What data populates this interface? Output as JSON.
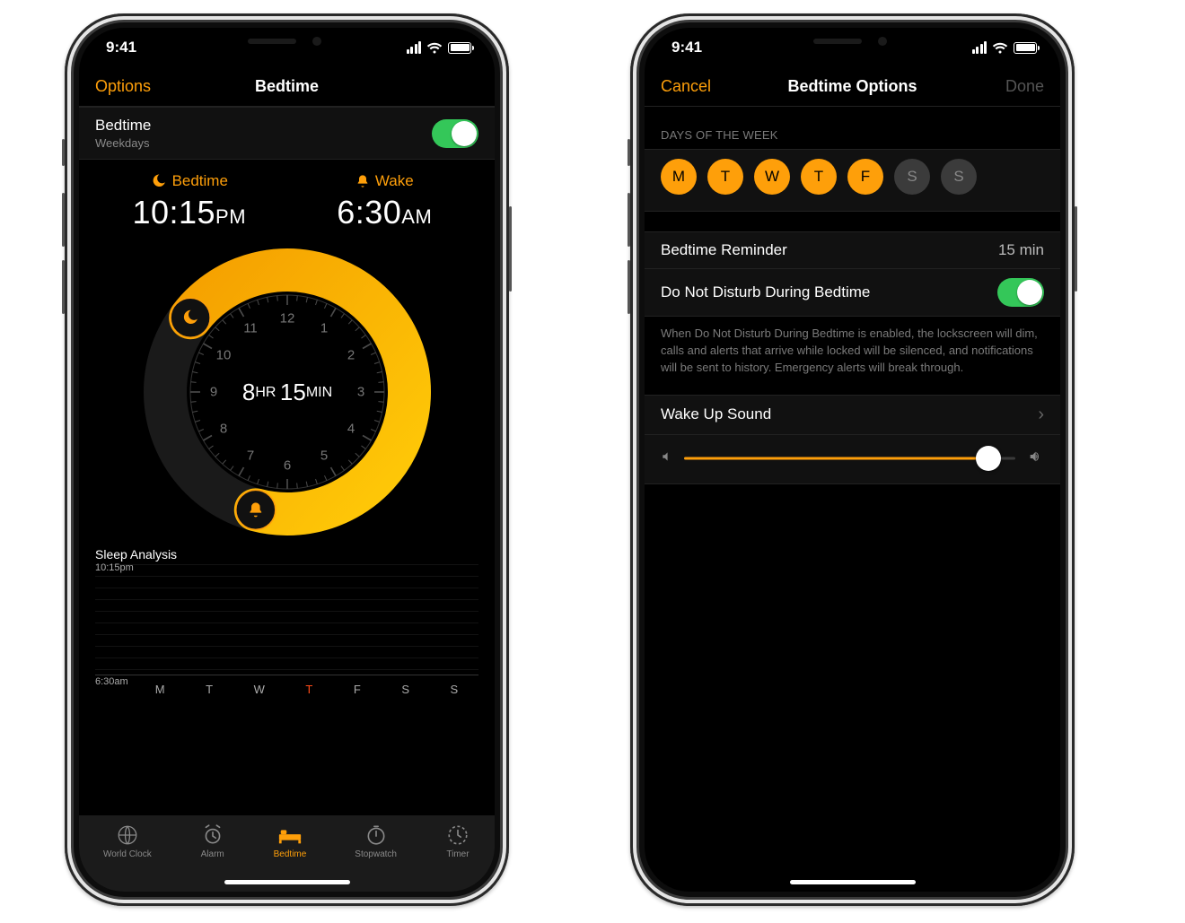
{
  "status": {
    "time": "9:41"
  },
  "left": {
    "nav": {
      "leftBtn": "Options",
      "title": "Bedtime"
    },
    "bedtimeRow": {
      "title": "Bedtime",
      "subtitle": "Weekdays"
    },
    "columns": {
      "bedtime": {
        "label": "Bedtime",
        "hhmm": "10:15",
        "ampm": "PM"
      },
      "wake": {
        "label": "Wake",
        "hhmm": "6:30",
        "ampm": "AM"
      }
    },
    "dial": {
      "durationHr": "8",
      "hrLabel": "HR",
      "durationMin": "15",
      "minLabel": "MIN",
      "startHourIndex": 10.25,
      "endHourIndex": 18.5
    },
    "analysis": {
      "title": "Sleep Analysis",
      "yTop": "10:15pm",
      "yBottom": "6:30am",
      "days": [
        "M",
        "T",
        "W",
        "T",
        "F",
        "S",
        "S"
      ],
      "highlightIndex": 3
    },
    "tabs": [
      {
        "label": "World Clock"
      },
      {
        "label": "Alarm"
      },
      {
        "label": "Bedtime",
        "active": true
      },
      {
        "label": "Stopwatch"
      },
      {
        "label": "Timer"
      }
    ]
  },
  "right": {
    "nav": {
      "leftBtn": "Cancel",
      "title": "Bedtime Options",
      "rightBtn": "Done"
    },
    "daysLabel": "DAYS OF THE WEEK",
    "days": [
      {
        "ch": "M",
        "on": true
      },
      {
        "ch": "T",
        "on": true
      },
      {
        "ch": "W",
        "on": true
      },
      {
        "ch": "T",
        "on": true
      },
      {
        "ch": "F",
        "on": true
      },
      {
        "ch": "S",
        "on": false
      },
      {
        "ch": "S",
        "on": false
      }
    ],
    "reminder": {
      "label": "Bedtime Reminder",
      "value": "15 min"
    },
    "dnd": {
      "label": "Do Not Disturb During Bedtime",
      "on": true
    },
    "dndDesc": "When Do Not Disturb During Bedtime is enabled, the lockscreen will dim, calls and alerts that arrive while locked will be silenced, and notifications will be sent to history. Emergency alerts will break through.",
    "wakeSound": {
      "label": "Wake Up Sound"
    },
    "volume": 0.92
  }
}
